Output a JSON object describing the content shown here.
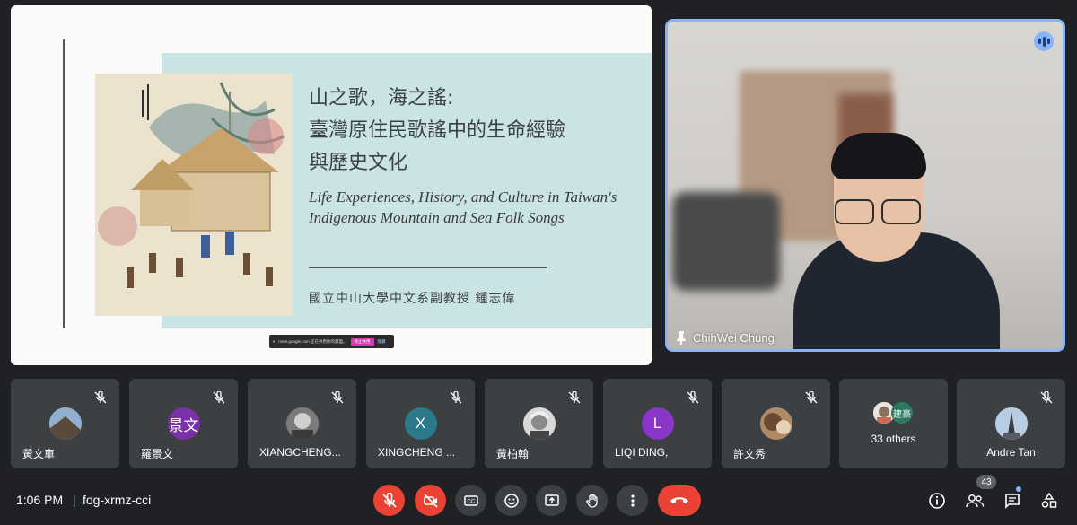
{
  "slide": {
    "title_line1": "山之歌，海之謠:",
    "title_line2": "臺灣原住民歌謠中的生命經驗",
    "title_line3": "與歷史文化",
    "subtitle": "Life Experiences, History, and Culture in Taiwan's Indigenous Mountain and Sea Folk Songs",
    "author": "國立中山大學中文系副教授  鍾志偉"
  },
  "share_bar": {
    "message": "meet.google.com 正在共用你的畫面。",
    "stop_label": "停止共用",
    "hide_label": "隱藏"
  },
  "speaker": {
    "name": "ChihWei Chung",
    "icon": "audio-level-icon",
    "pin_icon": "pin-icon"
  },
  "participants": [
    {
      "name": "黃文車",
      "avatar_type": "photo",
      "avatar_color": "#6b8fb0",
      "mic": "mic-off-icon"
    },
    {
      "name": "羅景文",
      "avatar_type": "initials",
      "initials": "景文",
      "avatar_color": "#7b2fa8",
      "mic": "mic-off-icon"
    },
    {
      "name": "XIANGCHENG...",
      "avatar_type": "photo",
      "avatar_color": "#9a9a9a",
      "mic": "mic-off-icon"
    },
    {
      "name": "XINGCHENG ...",
      "avatar_type": "initials",
      "initials": "X",
      "avatar_color": "#2b7a8c",
      "mic": "mic-off-icon"
    },
    {
      "name": "黃柏翰",
      "avatar_type": "photo",
      "avatar_color": "#bdbdbd",
      "mic": "mic-off-icon"
    },
    {
      "name": "LIQI DING,",
      "avatar_type": "initials",
      "initials": "L",
      "avatar_color": "#8b36c9",
      "mic": "mic-off-icon"
    },
    {
      "name": "許文秀",
      "avatar_type": "photo",
      "avatar_color": "#8a6a4f",
      "mic": "mic-off-icon"
    },
    {
      "name": "Andre Tan",
      "avatar_type": "photo",
      "avatar_color": "#9fb7d3",
      "mic": "mic-off-icon"
    }
  ],
  "others_tile": {
    "label": "33 others",
    "initials": "建豪",
    "avatar_color": "#2b7a60"
  },
  "bottombar": {
    "time": "1:06 PM",
    "separator": "|",
    "meeting_code": "fog-xrmz-cci",
    "participant_count": "43",
    "controls": [
      "mic-off-icon",
      "camera-off-icon",
      "captions-icon",
      "emoji-icon",
      "present-icon",
      "raise-hand-icon",
      "more-options-icon",
      "hang-up-icon"
    ],
    "right_controls": [
      "info-icon",
      "people-icon",
      "chat-icon",
      "activities-icon"
    ]
  },
  "colors": {
    "background": "#202124",
    "tile": "#3c4043",
    "danger": "#ea4335",
    "accent": "#8ab4f8"
  }
}
